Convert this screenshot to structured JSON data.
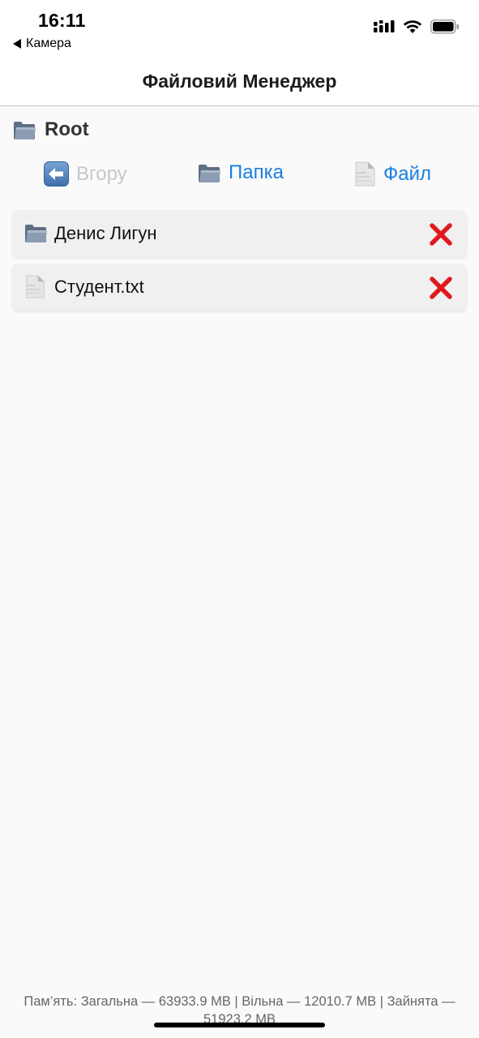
{
  "status_bar": {
    "time": "16:11",
    "back_label": "Камера"
  },
  "nav": {
    "title": "Файловий Менеджер"
  },
  "path": {
    "title": "Root",
    "icon": "folder-icon"
  },
  "toolbar": {
    "up_label": "Вгору",
    "folder_label": "Папка",
    "file_label": "Файл"
  },
  "items": [
    {
      "type": "folder",
      "name": "Денис Лигун",
      "icon": "folder-icon"
    },
    {
      "type": "file",
      "name": "Студент.txt",
      "icon": "file-icon"
    }
  ],
  "footer": {
    "memory_text": "Пам’ять: Загальна — 63933.9 MB | Вільна — 12010.7 MB | Зайнята — 51923.2 MB"
  },
  "colors": {
    "accent": "#1a7fe0",
    "disabled": "#c7c7cc",
    "delete": "#e0191f",
    "background": "#fafafa",
    "item_background": "#f0f0f0"
  }
}
